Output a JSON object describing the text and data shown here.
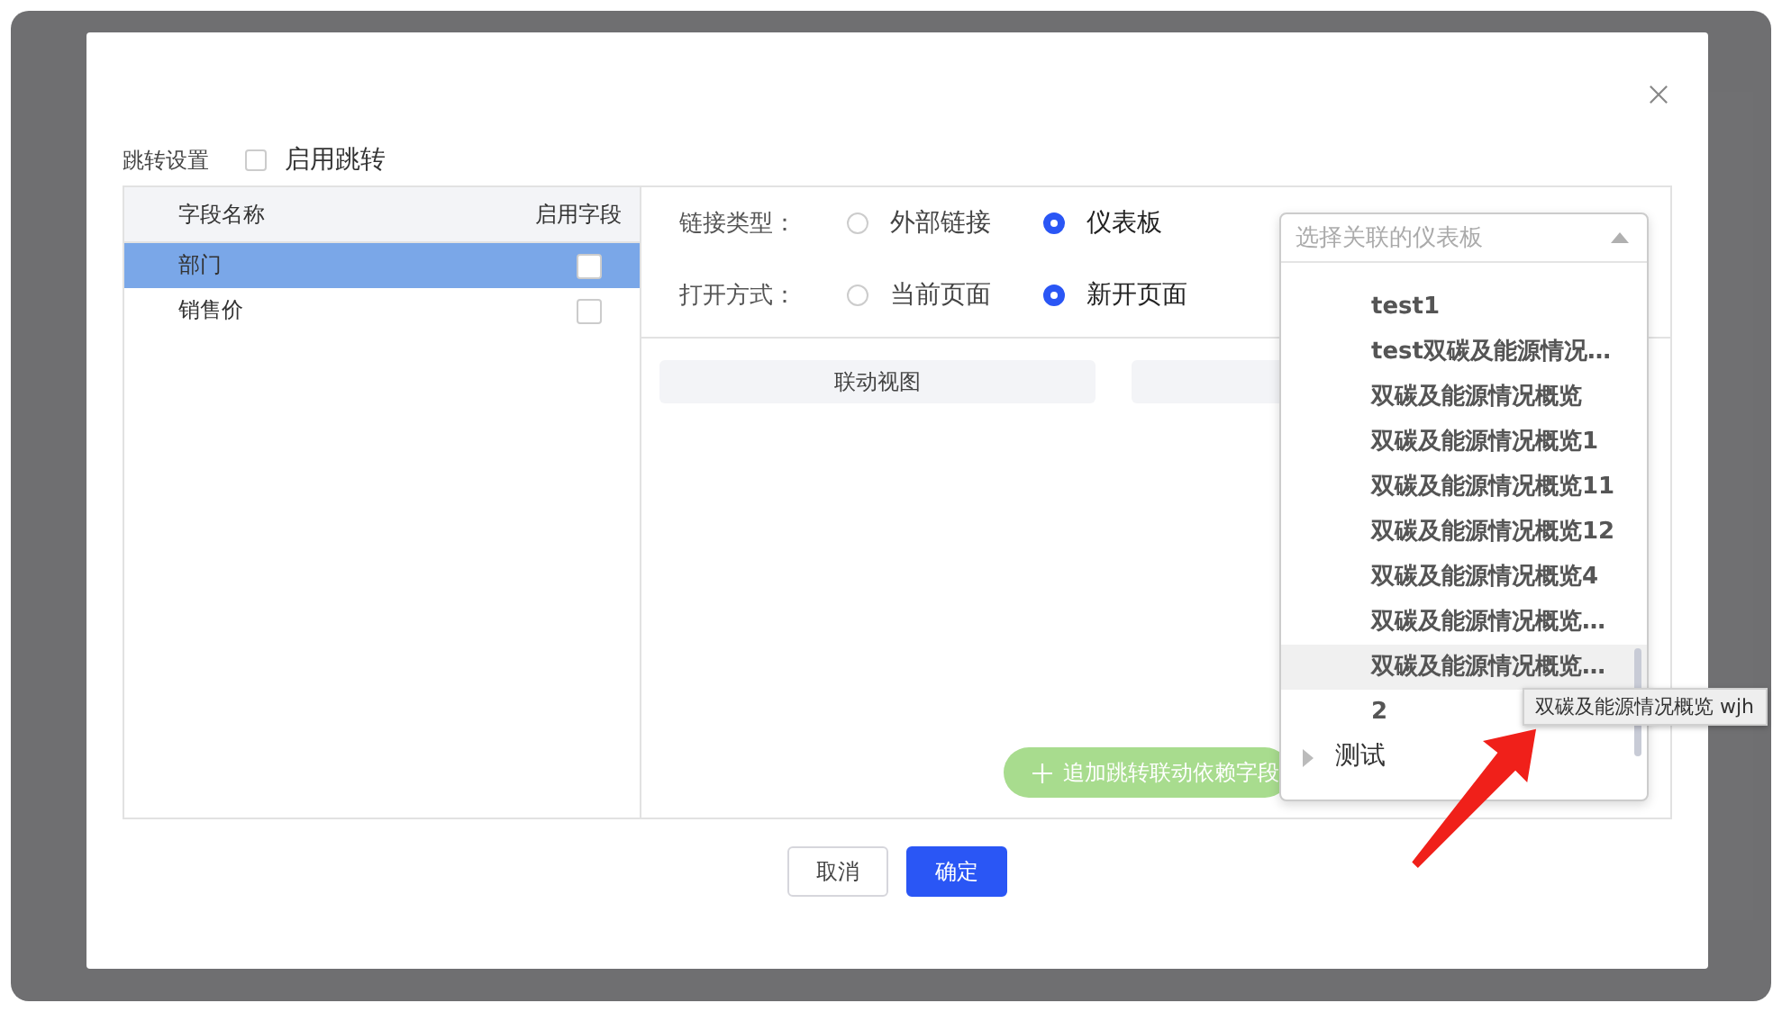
{
  "jump_settings": {
    "label": "跳转设置",
    "enable": {
      "label": "启用跳转",
      "checked": false
    }
  },
  "field_table": {
    "columns": [
      "字段名称",
      "启用字段"
    ],
    "rows": [
      {
        "name": "部门",
        "selected": true,
        "checked": false
      },
      {
        "name": "销售价",
        "selected": false,
        "checked": false
      }
    ]
  },
  "link_type": {
    "label": "链接类型：",
    "options": [
      {
        "label": "外部链接",
        "selected": false
      },
      {
        "label": "仪表板",
        "selected": true
      }
    ]
  },
  "open_mode": {
    "label": "打开方式：",
    "options": [
      {
        "label": "当前页面",
        "selected": false
      },
      {
        "label": "新开页面",
        "selected": true
      }
    ]
  },
  "view_tabs": [
    {
      "label": "联动视图"
    }
  ],
  "add_button": {
    "label": "追加跳转联动依赖字段",
    "disabled": true
  },
  "dashboard_select": {
    "placeholder": "选择关联的仪表板",
    "expanded": true,
    "items": [
      {
        "kind": "leaf",
        "label": "test1",
        "hovered": false
      },
      {
        "kind": "leaf",
        "label": "test双碳及能源情况…",
        "hovered": false
      },
      {
        "kind": "leaf",
        "label": "双碳及能源情况概览",
        "hovered": false
      },
      {
        "kind": "leaf",
        "label": "双碳及能源情况概览1",
        "hovered": false
      },
      {
        "kind": "leaf",
        "label": "双碳及能源情况概览11",
        "hovered": false
      },
      {
        "kind": "leaf",
        "label": "双碳及能源情况概览12",
        "hovered": false
      },
      {
        "kind": "leaf",
        "label": "双碳及能源情况概览4",
        "hovered": false
      },
      {
        "kind": "leaf",
        "label": "双碳及能源情况概览…",
        "hovered": false
      },
      {
        "kind": "leaf",
        "label": "双碳及能源情况概览…",
        "hovered": true
      },
      {
        "kind": "leaf",
        "label": "2",
        "hovered": false
      },
      {
        "kind": "folder",
        "label": "测试",
        "expanded": false
      }
    ]
  },
  "tooltip": "双碳及能源情况概览 wjh",
  "buttons": [
    {
      "label": "取消",
      "kind": "secondary"
    },
    {
      "label": "确定",
      "kind": "primary"
    }
  ]
}
